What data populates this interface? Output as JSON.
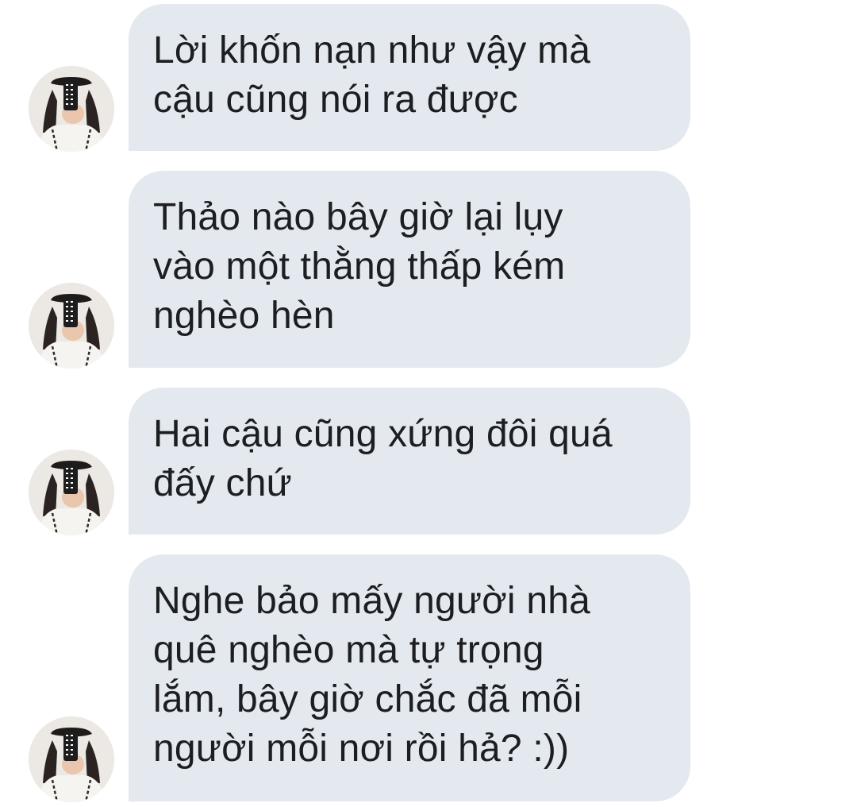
{
  "conversation": {
    "messages": [
      {
        "text": "Lời khốn nạn như vậy mà\ncậu cũng nói ra được"
      },
      {
        "text": "Thảo nào bây giờ lại lụy\nvào một thằng thấp kém\nnghèo hèn"
      },
      {
        "text": "Hai cậu cũng xứng đôi quá\nđấy chứ"
      },
      {
        "text": "Nghe bảo mấy người nhà\nquê nghèo mà tự trọng\nlắm, bây giờ chắc đã mỗi\nngười mỗi nơi rồi hả? :))"
      }
    ]
  }
}
